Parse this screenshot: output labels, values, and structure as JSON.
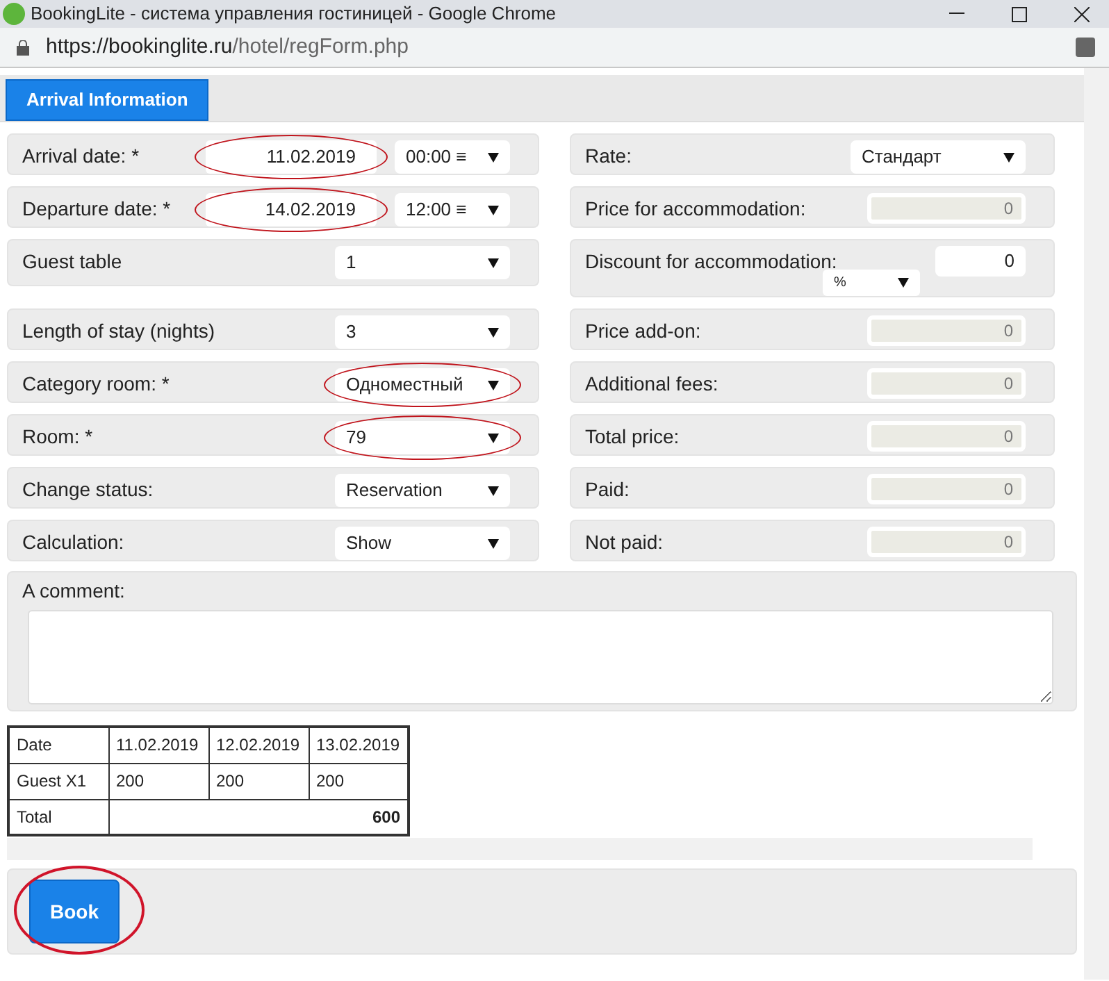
{
  "browser": {
    "title": "BookingLite - система управления гостиницей - Google Chrome",
    "url_host": "https://bookinglite.ru",
    "url_path": "/hotel/regForm.php"
  },
  "tabs": [
    {
      "label": "Arrival Information",
      "selected": true
    }
  ],
  "left_fields": [
    {
      "kind": "datetime",
      "label": "Arrival date: *",
      "value": "11.02.2019",
      "time": "00:00 ≡",
      "circled": true
    },
    {
      "kind": "datetime",
      "label": "Departure date: *",
      "value": "14.02.2019",
      "time": "12:00 ≡",
      "circled": true
    },
    {
      "kind": "select",
      "label": "Guest table",
      "value": "1",
      "circled": false
    },
    {
      "kind": "select",
      "label": "Length of stay (nights)",
      "value": "3",
      "circled": false
    },
    {
      "kind": "select",
      "label": "Category room: *",
      "value": "Одноместный",
      "circled": true
    },
    {
      "kind": "select",
      "label": "Room: *",
      "value": "79",
      "circled": true
    },
    {
      "kind": "select",
      "label": "Change status:",
      "value": "Reservation",
      "circled": false
    },
    {
      "kind": "select",
      "label": "Calculation:",
      "value": "Show",
      "circled": false
    }
  ],
  "right_fields": [
    {
      "kind": "select",
      "label": "Rate:",
      "value": "Стандарт"
    },
    {
      "kind": "readonly",
      "label": "Price for accommodation:",
      "value": "0"
    },
    {
      "kind": "discount",
      "label": "Discount for accommodation:",
      "value": "0",
      "unit": "%"
    },
    {
      "kind": "readonly",
      "label": "Price add-on:",
      "value": "0"
    },
    {
      "kind": "readonly",
      "label": "Additional fees:",
      "value": "0"
    },
    {
      "kind": "readonly",
      "label": "Total price:",
      "value": "0"
    },
    {
      "kind": "readonly",
      "label": "Paid:",
      "value": "0"
    },
    {
      "kind": "readonly",
      "label": "Not paid:",
      "value": "0"
    }
  ],
  "comment": {
    "label": "A comment:"
  },
  "price_table": {
    "header": [
      "Date",
      "11.02.2019",
      "12.02.2019",
      "13.02.2019"
    ],
    "rows": [
      [
        "Guest X1",
        "200",
        "200",
        "200"
      ]
    ],
    "total_label": "Total",
    "total": "600"
  },
  "book_button": {
    "label": "Book",
    "circled": true
  }
}
